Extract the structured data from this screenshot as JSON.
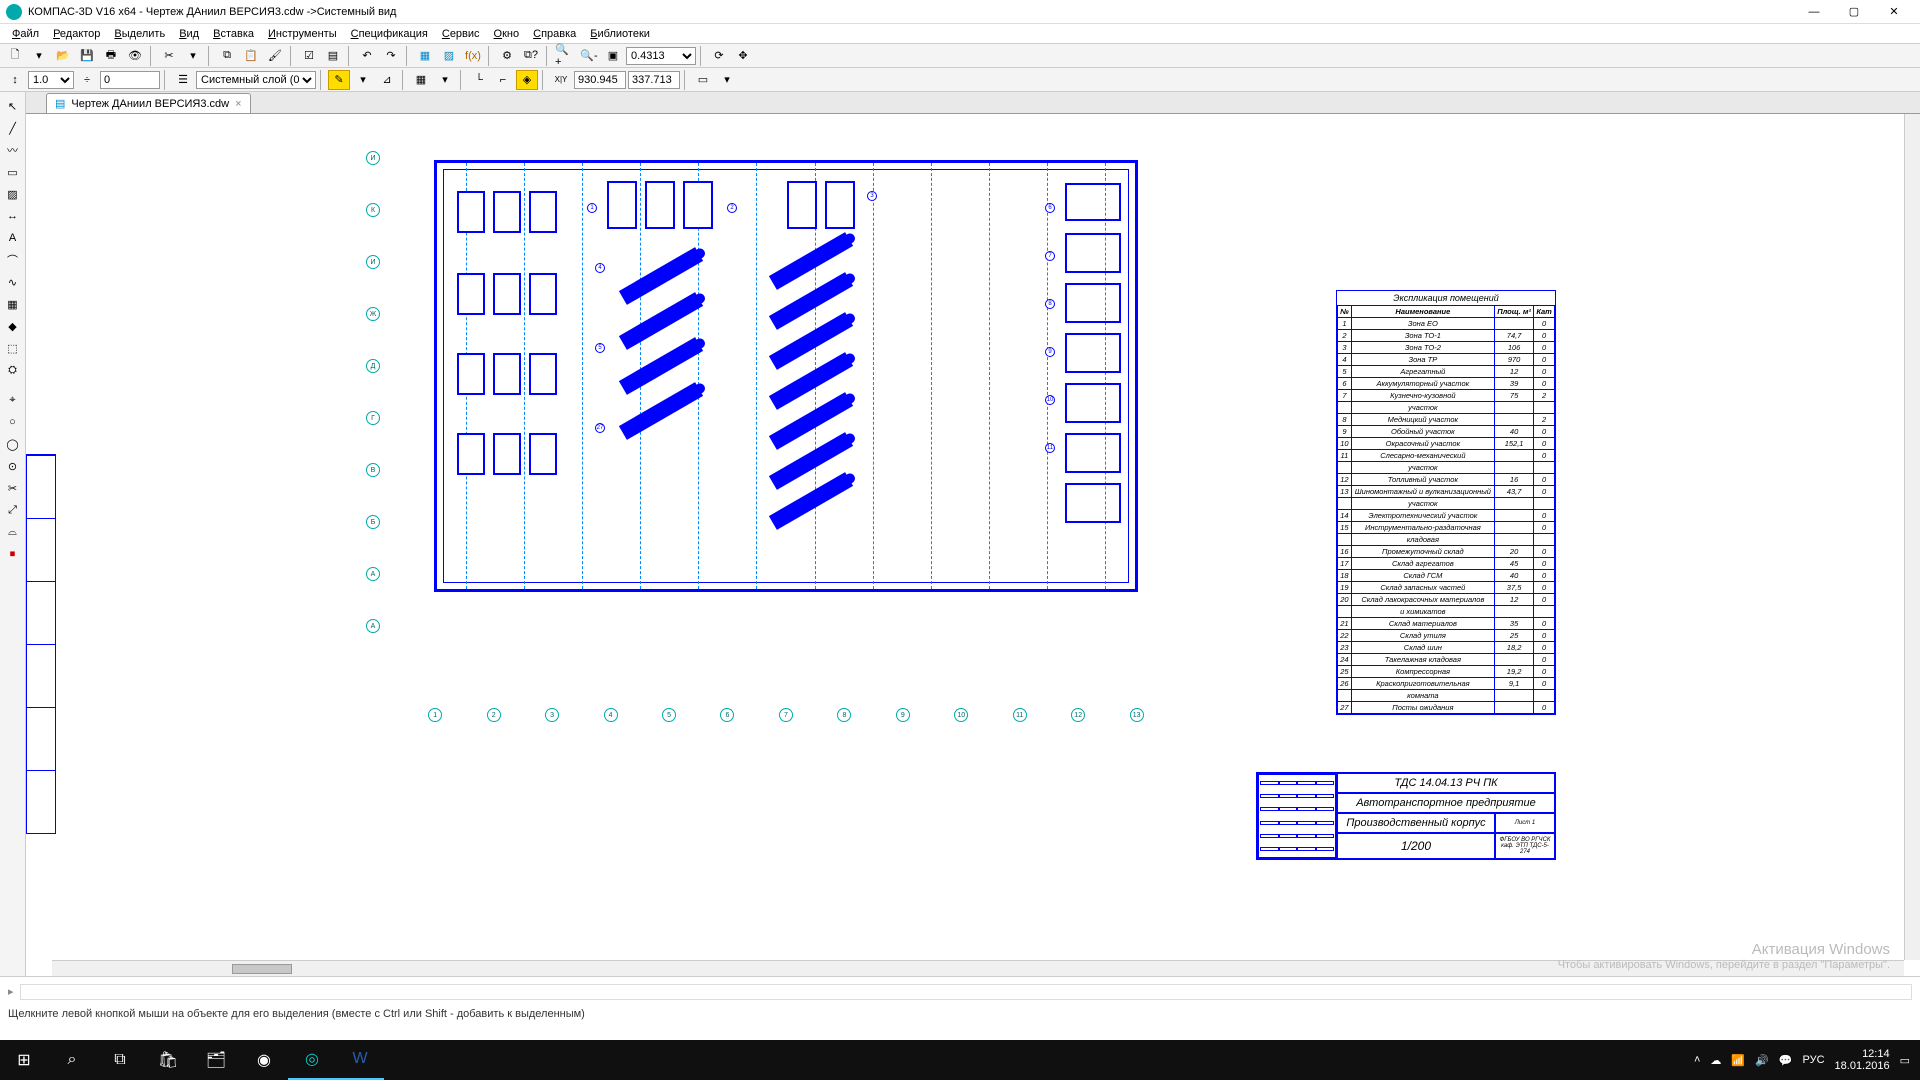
{
  "title": "КОМПАС-3D V16  x64 - Чертеж ДАниил ВЕРСИЯ3.cdw ->Системный вид",
  "menu": [
    "Файл",
    "Редактор",
    "Выделить",
    "Вид",
    "Вставка",
    "Инструменты",
    "Спецификация",
    "Сервис",
    "Окно",
    "Справка",
    "Библиотеки"
  ],
  "toolbar1": {
    "zoom_value": "0.4313"
  },
  "toolbar2": {
    "line_w": "1.0",
    "offset": "0",
    "layer": "Системный слой (0)",
    "coord_x": "930.945",
    "coord_y": "337.713"
  },
  "tab_label": "Чертеж ДАниил ВЕРСИЯ3.cdw",
  "table": {
    "title": "Экспликация помещений",
    "cols": [
      "№",
      "Наименование",
      "Площ. м²",
      "Кат"
    ],
    "rows": [
      [
        "1",
        "Зона ЕО",
        "",
        "0"
      ],
      [
        "2",
        "Зона ТО-1",
        "74,7",
        "0"
      ],
      [
        "3",
        "Зона ТО-2",
        "106",
        "0"
      ],
      [
        "4",
        "Зона ТР",
        "970",
        "0"
      ],
      [
        "5",
        "Агрегатный",
        "12",
        "0"
      ],
      [
        "6",
        "Аккумуляторный участок",
        "39",
        "0"
      ],
      [
        "7",
        "Кузнечно-кузовной",
        "75",
        "2"
      ],
      [
        "",
        "участок",
        "",
        ""
      ],
      [
        "8",
        "Медницкий участок",
        "",
        "2"
      ],
      [
        "9",
        "Обойный участок",
        "40",
        "0"
      ],
      [
        "10",
        "Окрасочный участок",
        "152,1",
        "0"
      ],
      [
        "11",
        "Слесарно-механический",
        "",
        "0"
      ],
      [
        "",
        "участок",
        "",
        ""
      ],
      [
        "12",
        "Топливный участок",
        "16",
        "0"
      ],
      [
        "13",
        "Шиномонтажный и вулканизационный",
        "43,7",
        "0"
      ],
      [
        "",
        "участок",
        "",
        ""
      ],
      [
        "14",
        "Электротехнический участок",
        "",
        "0"
      ],
      [
        "15",
        "Инструментально-раздаточная",
        "",
        "0"
      ],
      [
        "",
        "кладовая",
        "",
        ""
      ],
      [
        "16",
        "Промежуточный склад",
        "20",
        "0"
      ],
      [
        "17",
        "Склад агрегатов",
        "45",
        "0"
      ],
      [
        "18",
        "Склад ГСМ",
        "40",
        "0"
      ],
      [
        "19",
        "Склад запасных частей",
        "37,5",
        "0"
      ],
      [
        "20",
        "Склад лакокрасочных материалов",
        "12",
        "0"
      ],
      [
        "",
        "и химикатов",
        "",
        ""
      ],
      [
        "21",
        "Склад материалов",
        "35",
        "0"
      ],
      [
        "22",
        "Склад утиля",
        "25",
        "0"
      ],
      [
        "23",
        "Склад шин",
        "18,2",
        "0"
      ],
      [
        "24",
        "Такелажная кладовая",
        "",
        "0"
      ],
      [
        "25",
        "Компрессорная",
        "19,2",
        "0"
      ],
      [
        "26",
        "Краскоприготовительная",
        "9,1",
        "0"
      ],
      [
        "",
        "комната",
        "",
        ""
      ],
      [
        "27",
        "Посты ожидания",
        "",
        "0"
      ]
    ]
  },
  "stamp": {
    "code": "ТДС 14.04.13 РЧ ПК",
    "proj": "Автотранспортное предприятие",
    "obj": "Производственный корпус",
    "scale": "1/200",
    "org": "ФГБОУ ВО РГЧСК каф. ЭТП ТДС-5-274"
  },
  "watermark1": "Активация Windows",
  "watermark2": "Чтобы активировать Windows, перейдите в раздел \"Параметры\".",
  "hint": "Щелкните левой кнопкой мыши на объекте для его выделения (вместе с Ctrl или Shift - добавить к выделенным)",
  "tray": {
    "lang": "РУС",
    "time": "12:14",
    "date": "18.01.2016"
  }
}
